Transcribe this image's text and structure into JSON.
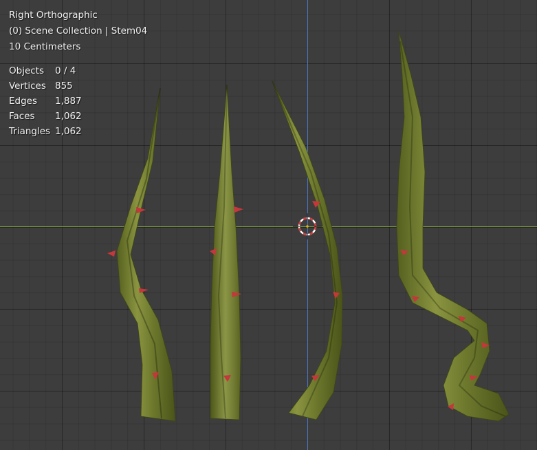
{
  "view": {
    "projection": "Right Orthographic",
    "collection": "(0) Scene Collection | Stem04",
    "scale": "10 Centimeters"
  },
  "stats": [
    {
      "label": "Objects",
      "value": "0 / 4"
    },
    {
      "label": "Vertices",
      "value": "855"
    },
    {
      "label": "Edges",
      "value": "1,887"
    },
    {
      "label": "Faces",
      "value": "1,062"
    },
    {
      "label": "Triangles",
      "value": "1,062"
    }
  ],
  "colors": {
    "background": "#3d3d3d",
    "x_axis": "#7fa33a",
    "z_axis": "#4d77c4",
    "stem": "#6f7a2e",
    "thorn": "#c4373a",
    "cursor_red": "#d43a3a"
  },
  "icons": [
    "3d-cursor-icon"
  ]
}
